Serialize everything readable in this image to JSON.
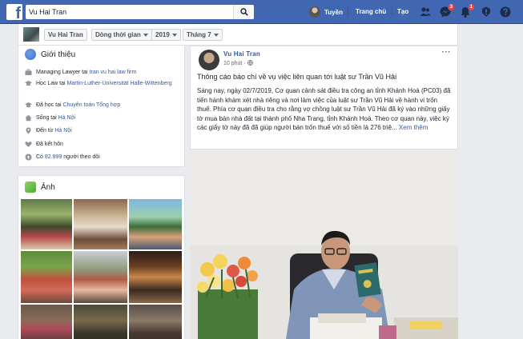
{
  "topbar": {
    "logo": "f",
    "search_value": "Vu Hai Tran",
    "user_name": "Tuyền",
    "home_label": "Trang chủ",
    "create_label": "Tạo",
    "messages_badge": "3",
    "notifications_badge": "1",
    "brand_color": "#4267b2"
  },
  "subbar": {
    "name": "Vu Hai Tran",
    "timeline": "Dòng thời gian",
    "year": "2019",
    "month": "Tháng 7"
  },
  "intro": {
    "title": "Giới thiệu",
    "work": {
      "prefix": "Managing Lawyer tại ",
      "link": "tran vu hai law firm"
    },
    "study": {
      "prefix": "Học Law tại ",
      "link": "Martin-Luther-Universität Halle-Wittenberg"
    },
    "school": {
      "prefix": "Đã học tại ",
      "link": "Chuyên toán Tổng hợp"
    },
    "lives": {
      "prefix": "Sống tại ",
      "link": "Hà Nội"
    },
    "from": {
      "prefix": "Đến từ ",
      "link": "Hà Nội"
    },
    "relationship": "Đã kết hôn",
    "followers": {
      "prefix": "Có ",
      "count": "82.999",
      "suffix": " người theo dõi"
    }
  },
  "photos": {
    "title": "Ảnh"
  },
  "post": {
    "author": "Vu Hai Tran",
    "time": "10 phút",
    "more": "···",
    "title": "Thông cáo báo chí về vụ việc liên quan tới luật sư Trần Vũ Hải",
    "body": "Sáng nay, ngày 02/7/2019, Cơ quan cảnh sát điều tra công an tỉnh Khánh Hoà (PC03) đã tiến hành khám xét nhà riêng và nơi làm việc của luật sư Trần Vũ Hải về hành vi trốn thuế. Phía cơ quan điều tra cho rằng vợ chồng luật sư Trần Vũ Hải đã ký vào những giấy tờ mua bán nhà đất tại thành phố Nha Trang, tỉnh Khánh Hoà. Theo cơ quan này, việc ký các giấy tờ này đã đã giúp người bán trốn thuế với số tiền là 276 triệ...",
    "see_more": "Xem thêm"
  }
}
